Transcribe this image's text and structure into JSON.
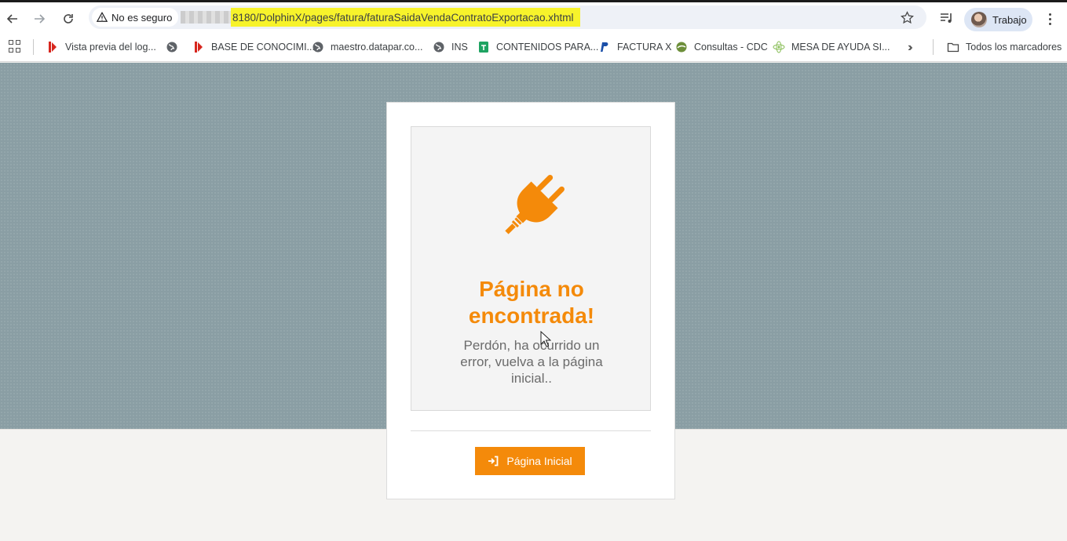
{
  "browser": {
    "security_label": "No es seguro",
    "url_highlighted": "8180/DolphinX/pages/fatura/faturaSaidaVendaContratoExportacao.xhtml",
    "profile_name": "Trabajo"
  },
  "bookmarks": {
    "items": [
      {
        "label": "Vista previa del log...",
        "icon": "red-flag-icon"
      },
      {
        "label": "BASE DE CONOCIMI...",
        "icon": "red-flag-icon"
      },
      {
        "label": "maestro.datapar.co...",
        "icon": "globe-icon"
      },
      {
        "label": "INS",
        "icon": "globe-icon"
      },
      {
        "label": "CONTENIDOS PARA...",
        "icon": "sheets-icon"
      },
      {
        "label": "FACTURA X",
        "icon": "paypal-icon"
      },
      {
        "label": "Consultas - CDC",
        "icon": "green-leaf-icon"
      },
      {
        "label": "MESA DE AYUDA SI...",
        "icon": "green-atom-icon"
      }
    ],
    "all_bookmarks_label": "Todos los marcadores"
  },
  "error_page": {
    "title": "Página no encontrada!",
    "message": "Perdón, ha ocurrido un error, vuelva a la página inicial..",
    "button_label": "Página Inicial",
    "accent_color": "#f48a0a"
  }
}
